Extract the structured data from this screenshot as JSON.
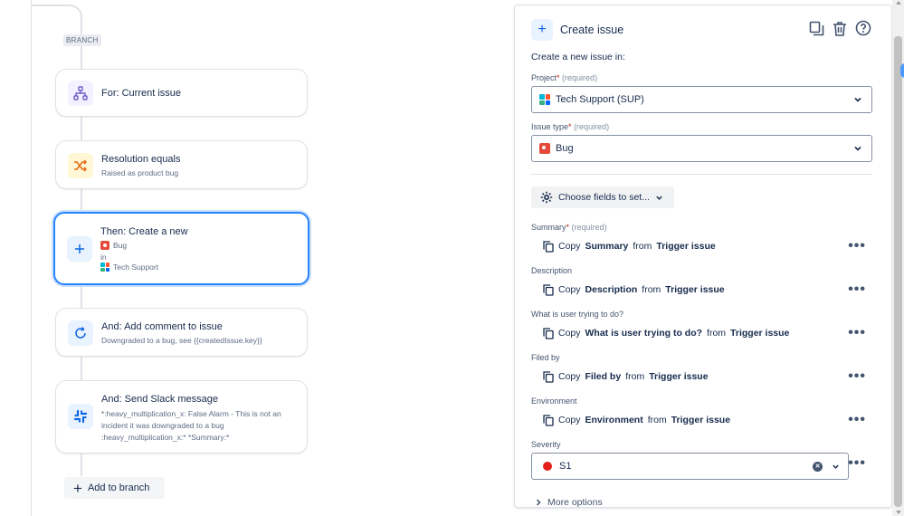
{
  "canvas": {
    "branch_tag": "BRANCH",
    "cards": [
      {
        "title": "For: Current issue",
        "icon": "branch-hierarchy-icon"
      },
      {
        "title": "Resolution equals",
        "subtitle": "Raised as product bug",
        "icon": "shuffle-icon"
      },
      {
        "title": "Then: Create a new",
        "line1": "Bug",
        "line2": "in",
        "line3": "Tech Support",
        "icon": "plus-icon"
      },
      {
        "title": "And: Add comment to issue",
        "subtitle": "Downgraded to a bug, see {{createdIssue.key}}",
        "icon": "refresh-comment-icon"
      },
      {
        "title": "And: Send Slack message",
        "line1": "*:heavy_multiplication_x: False Alarm - This is not an",
        "line2": "incident it was downgraded to a bug",
        "line3": ":heavy_multiplication_x:* *Summary:*",
        "icon": "slack-icon"
      }
    ],
    "add_branch_label": "Add to branch"
  },
  "panel": {
    "title": "Create issue",
    "intro": "Create a new issue in:",
    "project": {
      "label": "Project",
      "required_mark": "*",
      "required_text": "(required)",
      "value": "Tech Support (SUP)"
    },
    "issue_type": {
      "label": "Issue type",
      "required_mark": "*",
      "required_text": "(required)",
      "value": "Bug"
    },
    "choose_fields_label": "Choose fields to set...",
    "fields": [
      {
        "label": "Summary",
        "required_mark": "*",
        "required_text": "(required)",
        "copy": "Copy",
        "field": "Summary",
        "from": "from",
        "source": "Trigger issue"
      },
      {
        "label": "Description",
        "copy": "Copy",
        "field": "Description",
        "from": "from",
        "source": "Trigger issue"
      },
      {
        "label": "What is user trying to do?",
        "copy": "Copy",
        "field": "What is user trying to do?",
        "from": "from",
        "source": "Trigger issue"
      },
      {
        "label": "Filed by",
        "copy": "Copy",
        "field": "Filed by",
        "from": "from",
        "source": "Trigger issue"
      },
      {
        "label": "Environment",
        "copy": "Copy",
        "field": "Environment",
        "from": "from",
        "source": "Trigger issue"
      }
    ],
    "severity": {
      "label": "Severity",
      "value": "S1"
    },
    "more_options_label": "More options"
  },
  "colors": {
    "accent": "#2684ff",
    "bug": "#e5493a",
    "severity_s1": "#e5201d"
  }
}
